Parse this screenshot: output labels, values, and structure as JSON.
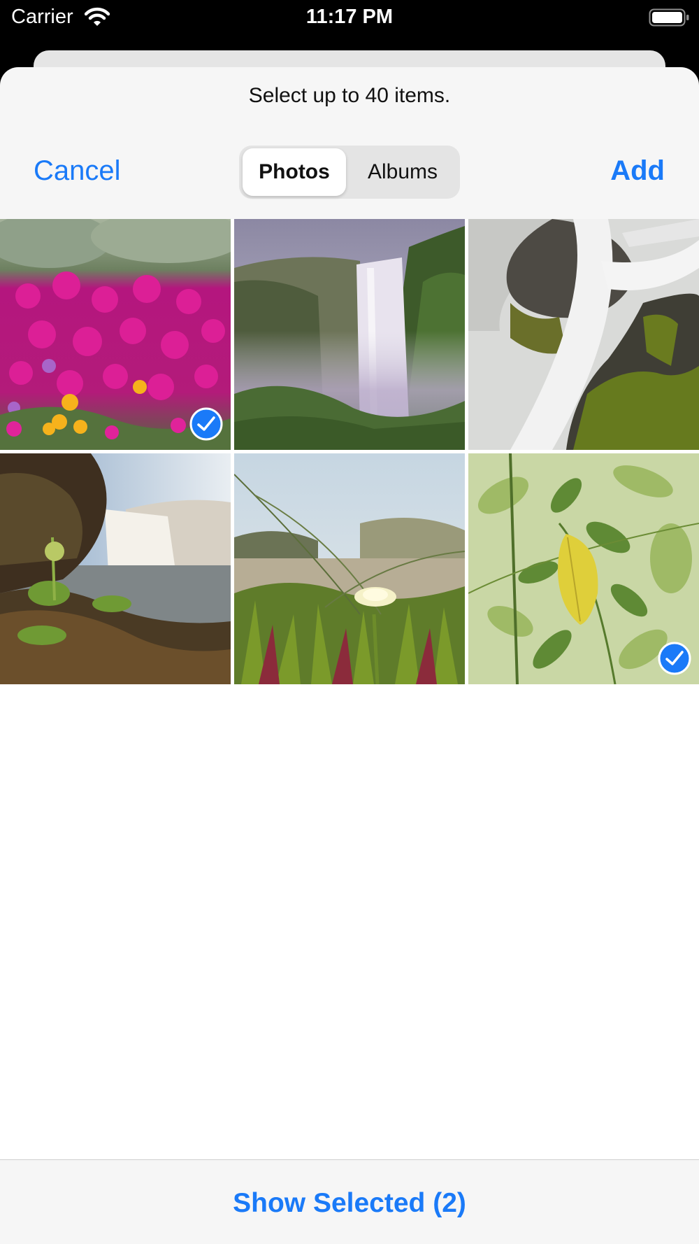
{
  "status_bar": {
    "carrier": "Carrier",
    "time": "11:17 PM"
  },
  "picker": {
    "prompt": "Select up to 40 items.",
    "cancel_label": "Cancel",
    "add_label": "Add",
    "segments": [
      "Photos",
      "Albums"
    ],
    "selected_segment": "Photos"
  },
  "photos": [
    {
      "subject": "pink-ice-plant-flowers",
      "selected": true
    },
    {
      "subject": "waterfall-in-green-cliffs",
      "selected": false
    },
    {
      "subject": "waterfall-over-mossy-rocks",
      "selected": false
    },
    {
      "subject": "waterfall-at-rocky-shore",
      "selected": false
    },
    {
      "subject": "yellow-flower-in-grass",
      "selected": false
    },
    {
      "subject": "yellow-leaf-on-green-branches",
      "selected": true
    }
  ],
  "bottom_bar": {
    "show_selected_label": "Show Selected (2)"
  },
  "colors": {
    "accent": "#1a7af8",
    "sheet": "#f6f6f6",
    "status_bar": "#000000"
  }
}
